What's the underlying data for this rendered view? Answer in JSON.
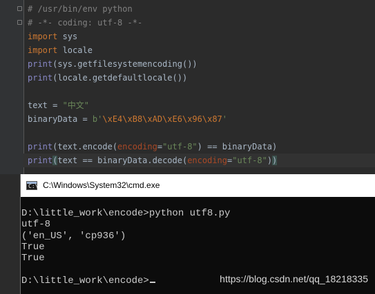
{
  "editor": {
    "lines": [
      [
        {
          "t": "# /usr/bin/env python",
          "c": "comment"
        }
      ],
      [
        {
          "t": "# -*- coding: utf-8 -*-",
          "c": "comment"
        }
      ],
      [
        {
          "t": "import",
          "c": "keyword"
        },
        {
          "t": " sys",
          "c": "plain"
        }
      ],
      [
        {
          "t": "import",
          "c": "keyword"
        },
        {
          "t": " locale",
          "c": "plain"
        }
      ],
      [
        {
          "t": "print",
          "c": "builtin"
        },
        {
          "t": "(sys.getfilesystemencoding())",
          "c": "plain"
        }
      ],
      [
        {
          "t": "print",
          "c": "builtin"
        },
        {
          "t": "(locale.getdefaultlocale())",
          "c": "plain"
        }
      ],
      [],
      [
        {
          "t": "text = ",
          "c": "plain"
        },
        {
          "t": "\"中文\"",
          "c": "string"
        }
      ],
      [
        {
          "t": "binaryData = ",
          "c": "plain"
        },
        {
          "t": "b'",
          "c": "string"
        },
        {
          "t": "\\xE4\\xB8\\xAD\\xE6\\x96\\x87",
          "c": "escape"
        },
        {
          "t": "'",
          "c": "string"
        }
      ],
      [],
      [
        {
          "t": "print",
          "c": "builtin"
        },
        {
          "t": "(text.encode(",
          "c": "plain"
        },
        {
          "t": "encoding",
          "c": "param"
        },
        {
          "t": "=",
          "c": "plain"
        },
        {
          "t": "\"utf-8\"",
          "c": "string"
        },
        {
          "t": ") == binaryData)",
          "c": "plain"
        }
      ],
      [
        {
          "t": "print",
          "c": "builtin"
        },
        {
          "t": "(",
          "c": "bracket"
        },
        {
          "t": "text == binaryData.decode(",
          "c": "plain"
        },
        {
          "t": "encoding",
          "c": "param"
        },
        {
          "t": "=",
          "c": "plain"
        },
        {
          "t": "\"utf-8\"",
          "c": "string"
        },
        {
          "t": ")",
          "c": "plain"
        },
        {
          "t": ")",
          "c": "bracket"
        }
      ]
    ]
  },
  "cmd": {
    "title": "C:\\Windows\\System32\\cmd.exe",
    "lines": [
      "D:\\little_work\\encode>python utf8.py",
      "utf-8",
      "('en_US', 'cp936')",
      "True",
      "True",
      "",
      "D:\\little_work\\encode>"
    ]
  },
  "watermark": "https://blog.csdn.net/qq_18218335"
}
